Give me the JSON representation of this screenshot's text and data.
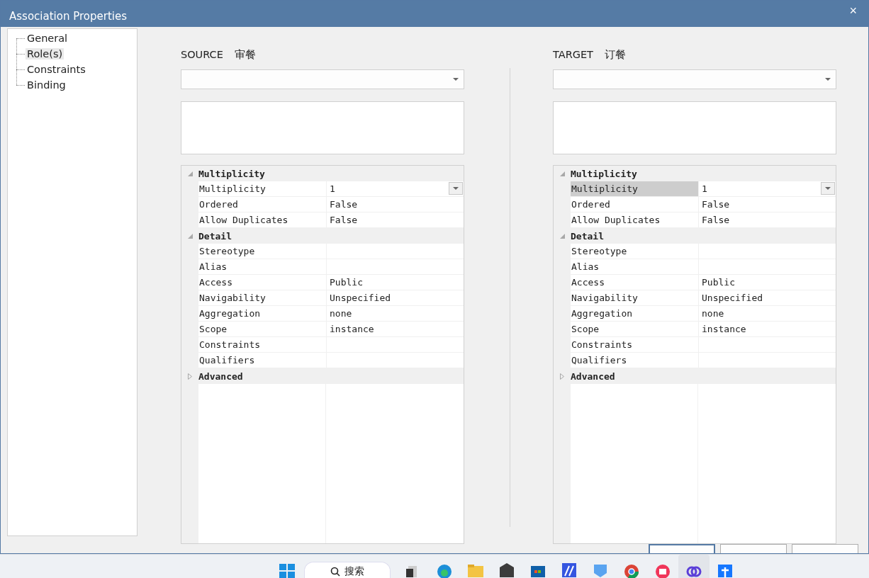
{
  "window": {
    "title": "Association Properties",
    "close": "×"
  },
  "tree": {
    "items": [
      {
        "label": "General",
        "selected": false
      },
      {
        "label": "Role(s)",
        "selected": true
      },
      {
        "label": "Constraints",
        "selected": false
      },
      {
        "label": "Binding",
        "selected": false
      }
    ]
  },
  "roles": [
    {
      "label": "SOURCE",
      "name": "审餐",
      "grid": [
        {
          "title": "Multiplicity",
          "expanded": true,
          "rows": [
            {
              "label": "Multiplicity",
              "value": "1",
              "kind": "dropdown",
              "selected": false
            },
            {
              "label": "Ordered",
              "value": "False",
              "kind": "text",
              "selected": false
            },
            {
              "label": "Allow Duplicates",
              "value": "False",
              "kind": "text",
              "selected": false
            }
          ]
        },
        {
          "title": "Detail",
          "expanded": true,
          "rows": [
            {
              "label": "Stereotype",
              "kind": "text",
              "selected": false
            },
            {
              "label": "Alias",
              "kind": "text",
              "selected": false
            },
            {
              "label": "Access",
              "value": "Public",
              "kind": "text",
              "selected": false
            },
            {
              "label": "Navigability",
              "value": "Unspecified",
              "kind": "text",
              "selected": false
            },
            {
              "label": "Aggregation",
              "value": "none",
              "kind": "text",
              "selected": false
            },
            {
              "label": "Scope",
              "value": "instance",
              "kind": "text",
              "selected": false
            },
            {
              "label": "Constraints",
              "kind": "text",
              "selected": false
            },
            {
              "label": "Qualifiers",
              "kind": "text",
              "selected": false
            }
          ]
        },
        {
          "title": "Advanced",
          "expanded": false
        }
      ]
    },
    {
      "label": "TARGET",
      "name": "订餐",
      "grid": [
        {
          "title": "Multiplicity",
          "expanded": true,
          "rows": [
            {
              "label": "Multiplicity",
              "value": "1",
              "kind": "dropdown",
              "selected": true
            },
            {
              "label": "Ordered",
              "value": "False",
              "kind": "text",
              "selected": false
            },
            {
              "label": "Allow Duplicates",
              "value": "False",
              "kind": "text",
              "selected": false
            }
          ]
        },
        {
          "title": "Detail",
          "expanded": true,
          "rows": [
            {
              "label": "Stereotype",
              "kind": "text",
              "selected": false
            },
            {
              "label": "Alias",
              "kind": "text",
              "selected": false
            },
            {
              "label": "Access",
              "value": "Public",
              "kind": "text",
              "selected": false
            },
            {
              "label": "Navigability",
              "value": "Unspecified",
              "kind": "text",
              "selected": false
            },
            {
              "label": "Aggregation",
              "value": "none",
              "kind": "text",
              "selected": false
            },
            {
              "label": "Scope",
              "value": "instance",
              "kind": "text",
              "selected": false
            },
            {
              "label": "Constraints",
              "kind": "text",
              "selected": false
            },
            {
              "label": "Qualifiers",
              "kind": "text",
              "selected": false
            }
          ]
        },
        {
          "title": "Advanced",
          "expanded": false
        }
      ]
    }
  ],
  "taskbar": {
    "search": {
      "placeholder": "搜索"
    }
  }
}
